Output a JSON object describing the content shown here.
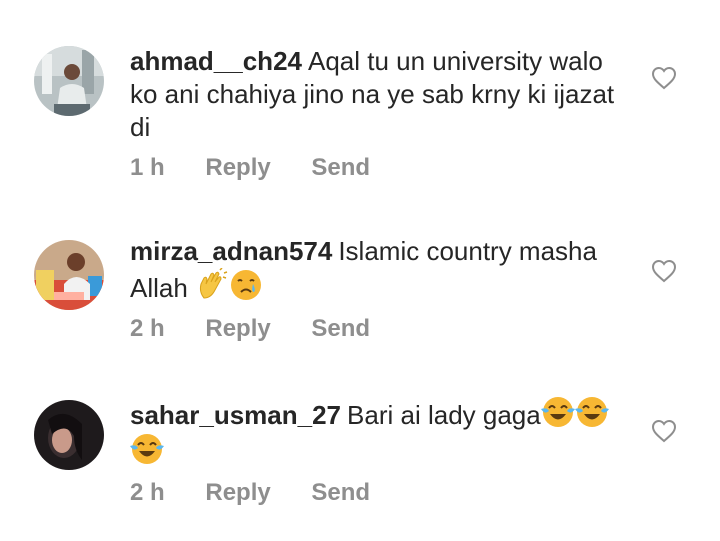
{
  "comments": [
    {
      "username": "ahmad__ch24",
      "text": "Aqal tu un university walo ko ani chahiya jino na ye sab krny ki ijazat di",
      "time": "1 h",
      "reply_label": "Reply",
      "send_label": "Send",
      "emojis": []
    },
    {
      "username": "mirza_adnan574",
      "text": "Islamic country masha Allah",
      "time": "2 h",
      "reply_label": "Reply",
      "send_label": "Send",
      "emojis": [
        "clapping-hands",
        "crying-face"
      ]
    },
    {
      "username": "sahar_usman_27",
      "text": "Bari ai lady gaga",
      "time": "2 h",
      "reply_label": "Reply",
      "send_label": "Send",
      "emojis": [
        "tears-of-joy",
        "tears-of-joy",
        "tears-of-joy"
      ]
    }
  ],
  "icons": {
    "like": "heart-outline-icon"
  },
  "colors": {
    "text": "#262626",
    "secondary": "#8e8e8e"
  }
}
